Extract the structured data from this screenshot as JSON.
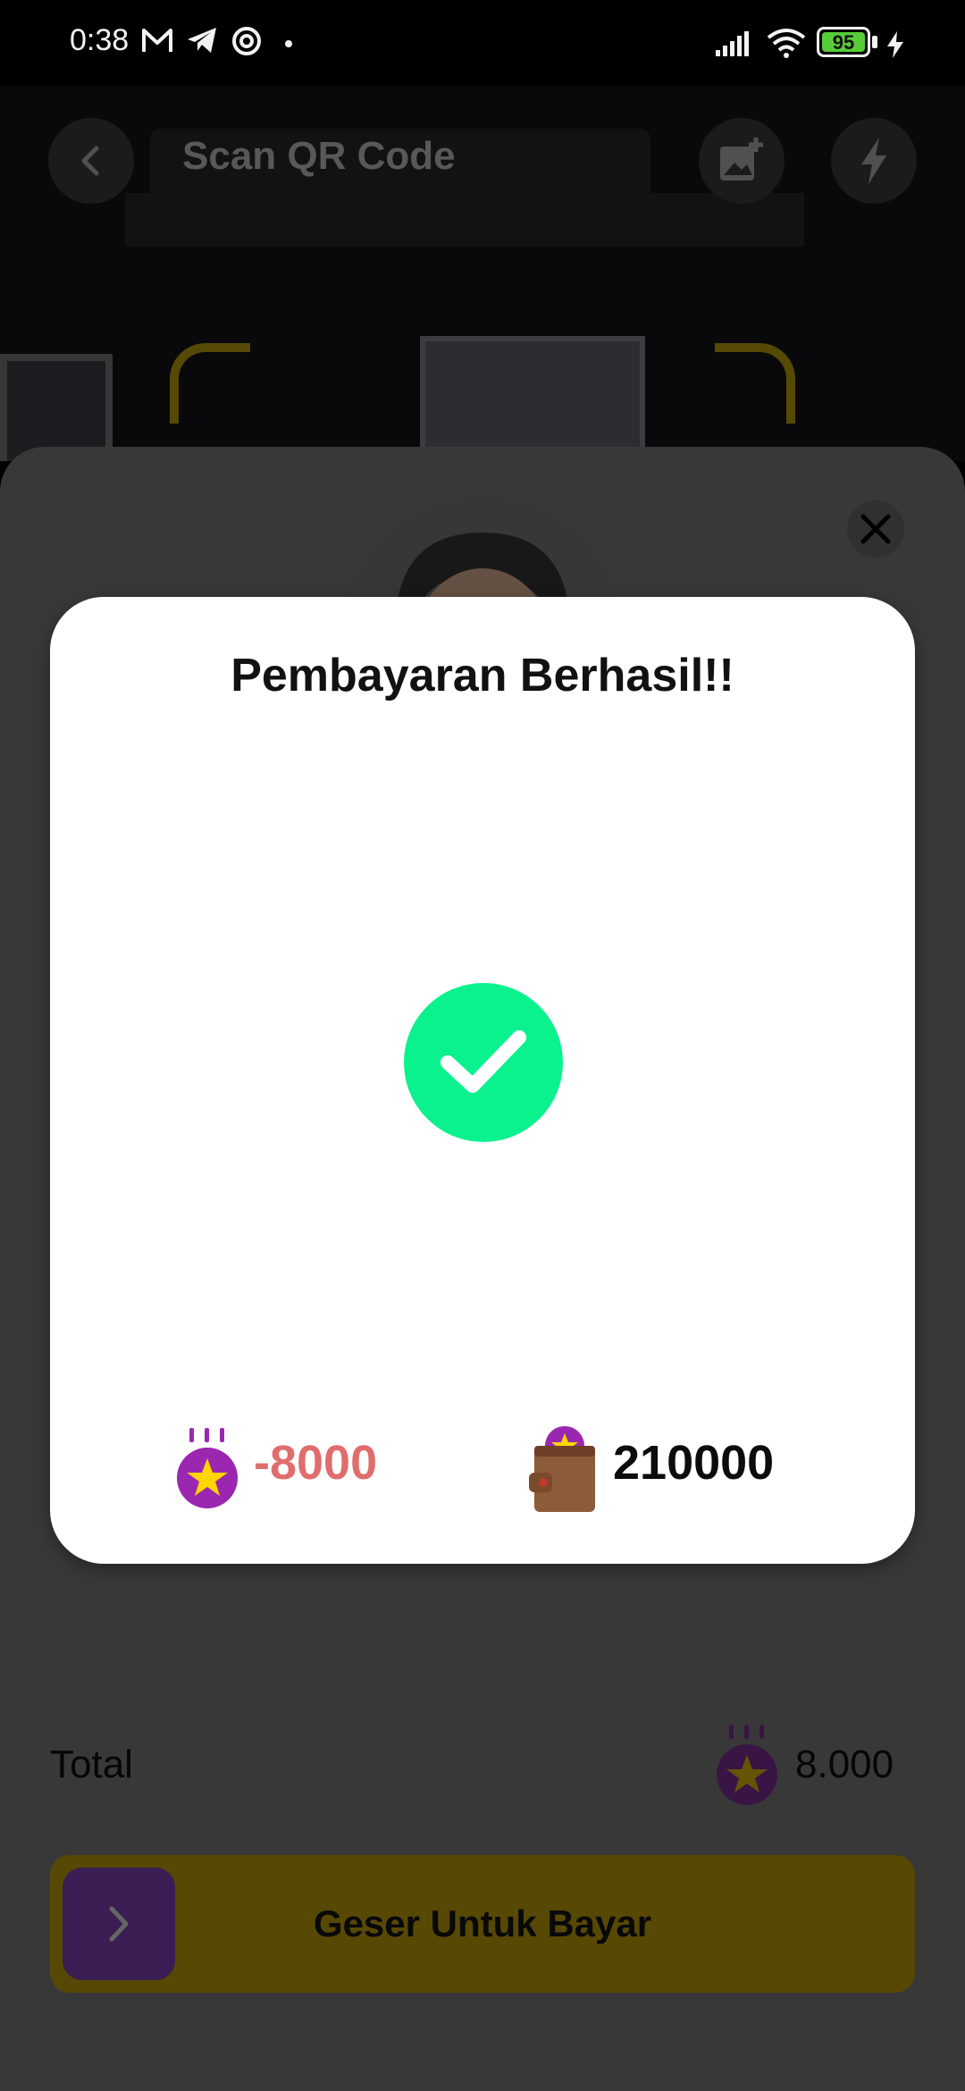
{
  "status_bar": {
    "time": "0:38",
    "battery_percent": "95",
    "battery_level": 0.95
  },
  "header": {
    "title": "Scan QR Code",
    "back_icon": "chevron-left-icon",
    "gallery_icon": "add-photo-icon",
    "flash_icon": "flash-icon"
  },
  "sheet": {
    "total_label": "Total",
    "total_amount": "8.000",
    "slider_label": "Geser Untuk Bayar"
  },
  "modal": {
    "title": "Pembayaran Berhasil!!",
    "deduction": "-8000",
    "balance": "210000"
  },
  "colors": {
    "success_green": "#0af28e",
    "deduction_red": "#e06d6d",
    "coin_purple": "#9b27b0",
    "coin_star": "#ffd600",
    "slider_yellow": "#ffd600",
    "slider_handle_purple": "#7b3fb0"
  }
}
